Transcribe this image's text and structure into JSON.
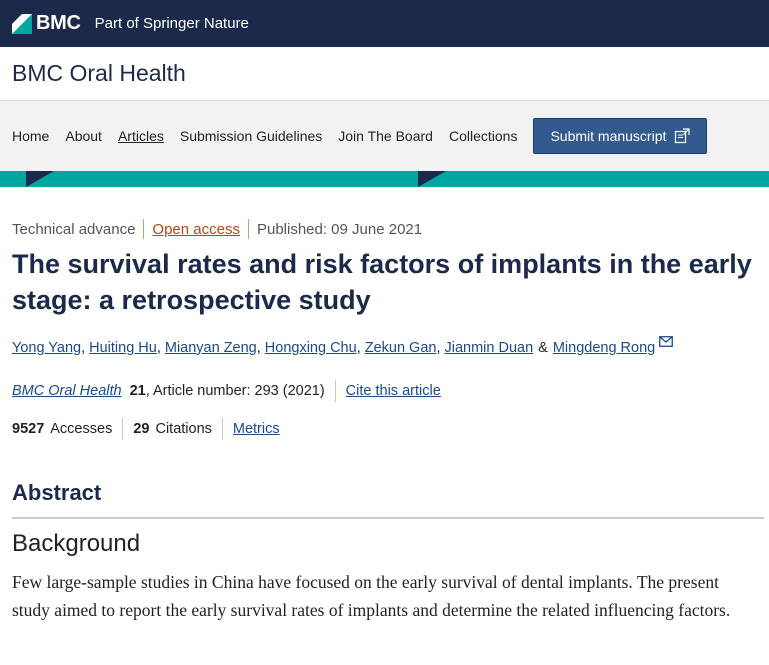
{
  "brand": {
    "name": "BMC",
    "tagline": "Part of Springer Nature"
  },
  "journal": {
    "title": "BMC Oral Health"
  },
  "nav": {
    "items": [
      "Home",
      "About",
      "Articles",
      "Submission Guidelines",
      "Join The Board",
      "Collections"
    ],
    "active": "Articles",
    "submit_label": "Submit manuscript"
  },
  "article": {
    "type": "Technical advance",
    "access": "Open access",
    "published": "Published: 09 June 2021",
    "title": "The survival rates and risk factors of implants in the early stage: a retrospective study",
    "authors": [
      "Yong Yang",
      "Huiting Hu",
      "Mianyan Zeng",
      "Hongxing Chu",
      "Zekun Gan",
      "Jianmin Duan",
      "Mingdeng Rong"
    ],
    "author_conjunction": "&",
    "journal_link": "BMC Oral Health",
    "volume": "21",
    "article_number": ", Article number: 293 (2021)",
    "cite_label": "Cite this article",
    "accesses_count": "9527",
    "accesses_label": "Accesses",
    "citations_count": "29",
    "citations_label": "Citations",
    "metrics_label": "Metrics"
  },
  "abstract": {
    "heading": "Abstract",
    "section_heading": "Background",
    "section_body": "Few large-sample studies in China have focused on the early survival of dental implants. The present study aimed to report the early survival rates of implants and determine the related influencing factors."
  },
  "colors": {
    "brand_navy": "#1b2a4a",
    "accent_teal": "#00a6a0",
    "button_blue": "#335a8e",
    "link_blue": "#1a4a8a",
    "open_access_orange": "#b8470f"
  },
  "icons": {
    "brand_logo": "bmc-logo-icon",
    "submit": "external-submit-icon",
    "mail": "envelope-icon"
  }
}
